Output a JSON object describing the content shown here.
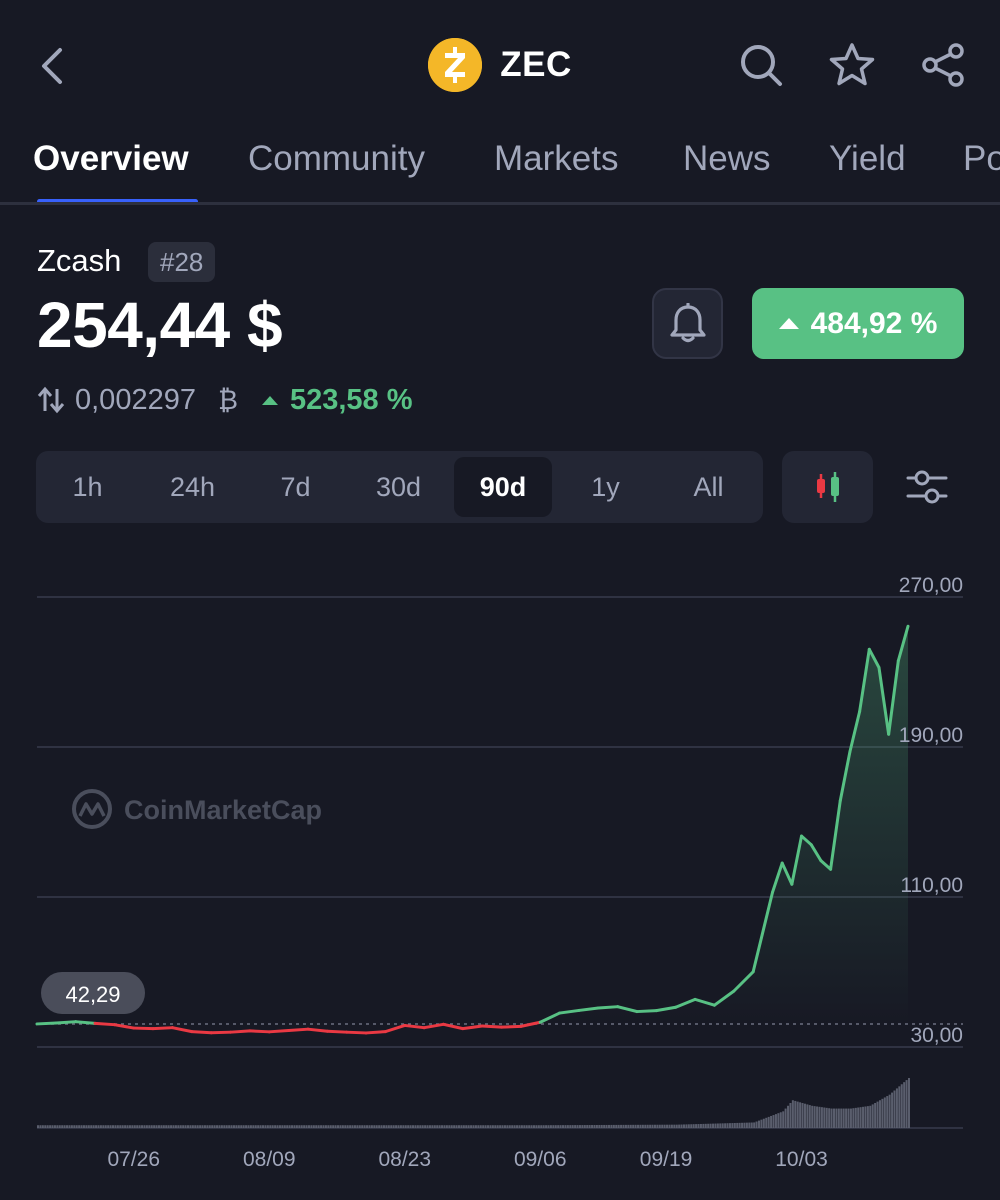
{
  "header": {
    "symbol": "ZEC",
    "logo_letter": "ⓩ",
    "back_icon": "chevron-left-icon",
    "actions": [
      "search-icon",
      "star-icon",
      "share-icon"
    ]
  },
  "tabs": [
    {
      "label": "Overview",
      "active": true
    },
    {
      "label": "Community"
    },
    {
      "label": "Markets"
    },
    {
      "label": "News"
    },
    {
      "label": "Yield"
    },
    {
      "label": "Portfolio"
    }
  ],
  "coin": {
    "name": "Zcash",
    "rank": "#28",
    "price": "254,44 $",
    "change": "484,92 %",
    "btc_value": "0,002297",
    "btc_symbol": "₿",
    "btc_change": "523,58 %"
  },
  "ranges": {
    "items": [
      "1h",
      "24h",
      "7d",
      "30d",
      "90d",
      "1y",
      "All"
    ],
    "selected": "90d"
  },
  "colors": {
    "background": "#171924",
    "up": "#58c184",
    "down": "#ea3943",
    "accent": "#3861fb",
    "muted": "#a1a7bb"
  },
  "chart_data": {
    "type": "line",
    "watermark": "CoinMarketCap",
    "baseline_label": "42,29",
    "baseline": 42.29,
    "y_tick_labels": [
      "270,00",
      "190,00",
      "110,00",
      "30,00"
    ],
    "y_ticks": [
      270,
      190,
      110,
      30
    ],
    "ylim": [
      30,
      270
    ],
    "x_tick_labels": [
      "07/26",
      "08/09",
      "08/23",
      "09/06",
      "09/19",
      "10/03"
    ],
    "x_ticks": [
      "2025-07-26",
      "2025-08-09",
      "2025-08-23",
      "2025-09-06",
      "2025-09-19",
      "2025-10-03"
    ],
    "series": [
      {
        "x": [
          "2025-07-16",
          "2025-07-18",
          "2025-07-20",
          "2025-07-22",
          "2025-07-24",
          "2025-07-26",
          "2025-07-28",
          "2025-07-30",
          "2025-08-01",
          "2025-08-03",
          "2025-08-05",
          "2025-08-07",
          "2025-08-09",
          "2025-08-11",
          "2025-08-13",
          "2025-08-15",
          "2025-08-17",
          "2025-08-19",
          "2025-08-21",
          "2025-08-23",
          "2025-08-25",
          "2025-08-27",
          "2025-08-29",
          "2025-08-31",
          "2025-09-02",
          "2025-09-04",
          "2025-09-06",
          "2025-09-08",
          "2025-09-10",
          "2025-09-12",
          "2025-09-14",
          "2025-09-16",
          "2025-09-18",
          "2025-09-20",
          "2025-09-22",
          "2025-09-24",
          "2025-09-26",
          "2025-09-28",
          "2025-09-30",
          "2025-10-01",
          "2025-10-02",
          "2025-10-03",
          "2025-10-04",
          "2025-10-05",
          "2025-10-06",
          "2025-10-07",
          "2025-10-08",
          "2025-10-09",
          "2025-10-10",
          "2025-10-11",
          "2025-10-12",
          "2025-10-13",
          "2025-10-14"
        ],
        "y": [
          42.3,
          42.8,
          43.5,
          42.6,
          41.9,
          40.1,
          39.8,
          40.3,
          38.2,
          37.6,
          37.9,
          38.6,
          38.1,
          38.8,
          39.5,
          38.4,
          37.9,
          37.5,
          38.2,
          41.5,
          40.3,
          42.1,
          39.8,
          41.2,
          40.6,
          41.0,
          43.2,
          48.1,
          49.5,
          50.8,
          51.5,
          48.9,
          49.4,
          51.2,
          55.4,
          52.3,
          59.8,
          70.1,
          112.5,
          128.1,
          116.8,
          142.5,
          137.9,
          129.4,
          124.8,
          161.3,
          187.5,
          208.9,
          242.1,
          232.4,
          196.8,
          236.0,
          254.4
        ]
      }
    ],
    "volume": {
      "x": [
        "2025-07-16",
        "2025-08-01",
        "2025-08-20",
        "2025-09-06",
        "2025-09-20",
        "2025-09-28",
        "2025-10-01",
        "2025-10-02",
        "2025-10-04",
        "2025-10-06",
        "2025-10-08",
        "2025-10-10",
        "2025-10-12",
        "2025-10-14"
      ],
      "values": [
        1,
        1,
        1,
        1,
        1.2,
        2,
        6,
        10,
        8,
        7,
        7,
        8,
        12,
        18
      ]
    }
  }
}
